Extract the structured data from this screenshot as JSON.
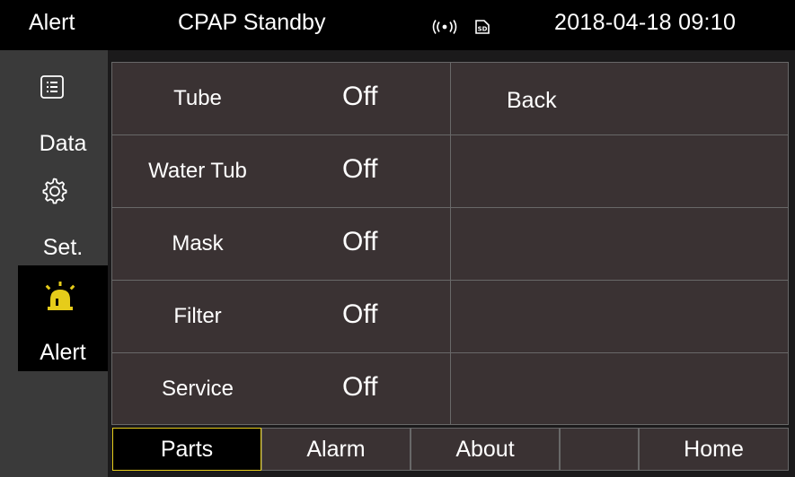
{
  "header": {
    "mode": "Alert",
    "status": "CPAP Standby",
    "datetime": "2018-04-18 09:10",
    "wifi_icon": "wifi-signal-icon",
    "sd_icon": "sd-card-icon"
  },
  "sidebar": {
    "items": [
      {
        "label": "Data",
        "icon": "list-icon"
      },
      {
        "label": "Set.",
        "icon": "gear-icon"
      },
      {
        "label": "Alert",
        "icon": "alarm-light-icon",
        "active": true
      }
    ]
  },
  "alerts": {
    "rows": [
      {
        "label": "Tube",
        "value": "Off"
      },
      {
        "label": "Water Tub",
        "value": "Off"
      },
      {
        "label": "Mask",
        "value": "Off"
      },
      {
        "label": "Filter",
        "value": "Off"
      },
      {
        "label": "Service",
        "value": "Off"
      }
    ],
    "back_label": "Back"
  },
  "tabs": {
    "parts": "Parts",
    "alarm": "Alarm",
    "about": "About",
    "home": "Home"
  },
  "colors": {
    "accent": "#e6cc1a",
    "panel": "#3a3233",
    "sidebar": "#3a3a3a"
  }
}
